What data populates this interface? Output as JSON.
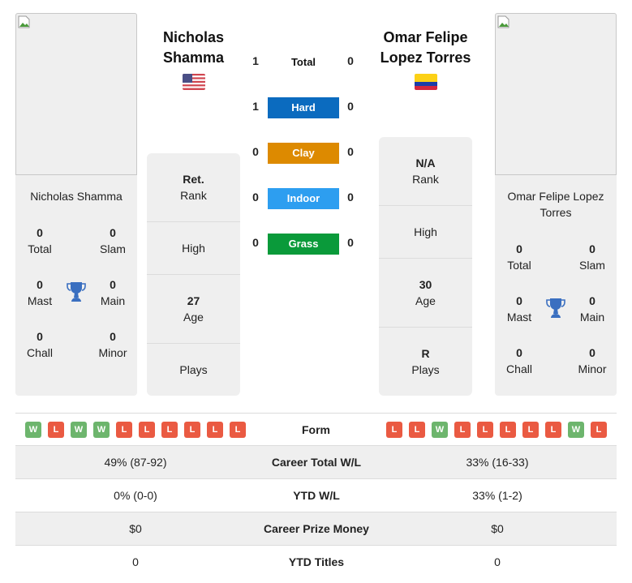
{
  "player1": {
    "name": "Nicholas Shamma",
    "heading_line1": "Nicholas",
    "heading_line2": "Shamma",
    "flag": "us-flag-icon",
    "card_name": "Nicholas Shamma",
    "titles": {
      "total": {
        "value": "0",
        "label": "Total"
      },
      "slam": {
        "value": "0",
        "label": "Slam"
      },
      "mast": {
        "value": "0",
        "label": "Mast"
      },
      "main": {
        "value": "0",
        "label": "Main"
      },
      "chall": {
        "value": "0",
        "label": "Chall"
      },
      "minor": {
        "value": "0",
        "label": "Minor"
      }
    },
    "info": {
      "rank": {
        "value": "Ret.",
        "label": "Rank"
      },
      "high": {
        "value": "",
        "label": "High"
      },
      "age": {
        "value": "27",
        "label": "Age"
      },
      "plays": {
        "value": "",
        "label": "Plays"
      }
    },
    "form": [
      "W",
      "L",
      "W",
      "W",
      "L",
      "L",
      "L",
      "L",
      "L",
      "L"
    ]
  },
  "player2": {
    "name": "Omar Felipe Lopez Torres",
    "heading_line1": "Omar Felipe",
    "heading_line2": "Lopez Torres",
    "flag": "colombia-flag-icon",
    "card_name_line1": "Omar Felipe Lopez",
    "card_name_line2": "Torres",
    "titles": {
      "total": {
        "value": "0",
        "label": "Total"
      },
      "slam": {
        "value": "0",
        "label": "Slam"
      },
      "mast": {
        "value": "0",
        "label": "Mast"
      },
      "main": {
        "value": "0",
        "label": "Main"
      },
      "chall": {
        "value": "0",
        "label": "Chall"
      },
      "minor": {
        "value": "0",
        "label": "Minor"
      }
    },
    "info": {
      "rank": {
        "value": "N/A",
        "label": "Rank"
      },
      "high": {
        "value": "",
        "label": "High"
      },
      "age": {
        "value": "30",
        "label": "Age"
      },
      "plays": {
        "value": "R",
        "label": "Plays"
      }
    },
    "form": [
      "L",
      "L",
      "W",
      "L",
      "L",
      "L",
      "L",
      "L",
      "W",
      "L"
    ]
  },
  "h2h": {
    "total": {
      "label": "Total",
      "p1": "1",
      "p2": "0"
    },
    "surfaces": [
      {
        "label": "Hard",
        "p1": "1",
        "p2": "0",
        "color": "#0b6bbf"
      },
      {
        "label": "Clay",
        "p1": "0",
        "p2": "0",
        "color": "#dd8a00"
      },
      {
        "label": "Indoor",
        "p1": "0",
        "p2": "0",
        "color": "#2d9ef0"
      },
      {
        "label": "Grass",
        "p1": "0",
        "p2": "0",
        "color": "#0a9a3a"
      }
    ]
  },
  "form_label": "Form",
  "stats": [
    {
      "label": "Career Total W/L",
      "p1": "49% (87-92)",
      "p2": "33% (16-33)"
    },
    {
      "label": "YTD W/L",
      "p1": "0% (0-0)",
      "p2": "33% (1-2)"
    },
    {
      "label": "Career Prize Money",
      "p1": "$0",
      "p2": "$0"
    },
    {
      "label": "YTD Titles",
      "p1": "0",
      "p2": "0"
    }
  ],
  "colors": {
    "win": "#6db56d",
    "loss": "#ea5a42",
    "trophy": "#3a6fc0",
    "panel": "#efefef"
  }
}
